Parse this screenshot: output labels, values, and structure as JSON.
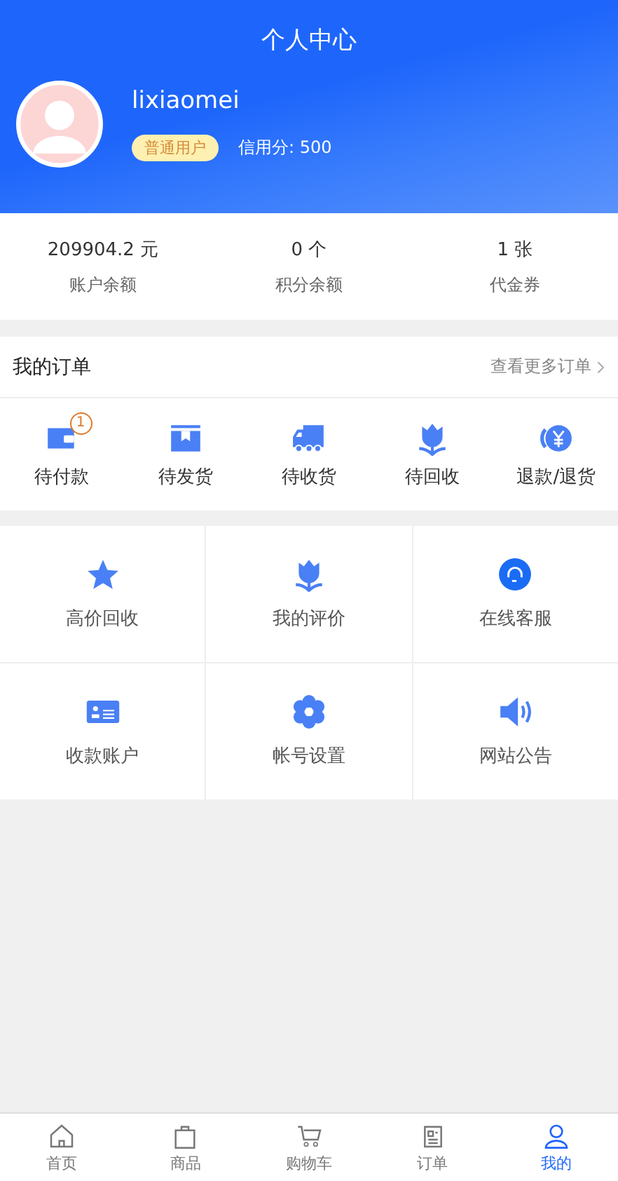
{
  "title": "个人中心",
  "profile": {
    "username": "lixiaomei",
    "level_badge": "普通用户",
    "credit": "信用分: 500"
  },
  "stats": [
    {
      "value": "209904.2 元",
      "label": "账户余额"
    },
    {
      "value": "0 个",
      "label": "积分余额"
    },
    {
      "value": "1 张",
      "label": "代金券"
    }
  ],
  "orders": {
    "heading": "我的订单",
    "more_link": "查看更多订单",
    "items": [
      {
        "kind": "wallet",
        "label": "待付款",
        "badge": "1"
      },
      {
        "kind": "box",
        "label": "待发货"
      },
      {
        "kind": "truck",
        "label": "待收货"
      },
      {
        "kind": "tulip",
        "label": "待回收"
      },
      {
        "kind": "refund",
        "label": "退款/退货"
      }
    ]
  },
  "services": [
    {
      "kind": "star",
      "label": "高价回收"
    },
    {
      "kind": "tulip",
      "label": "我的评价"
    },
    {
      "kind": "headset",
      "label": "在线客服"
    },
    {
      "kind": "idcard",
      "label": "收款账户"
    },
    {
      "kind": "gear",
      "label": "帐号设置"
    },
    {
      "kind": "speaker",
      "label": "网站公告"
    }
  ],
  "tabbar": [
    {
      "kind": "home",
      "label": "首页",
      "selected": false
    },
    {
      "kind": "bag",
      "label": "商品",
      "selected": false
    },
    {
      "kind": "cart",
      "label": "购物车",
      "selected": false
    },
    {
      "kind": "doc",
      "label": "订单",
      "selected": false
    },
    {
      "kind": "user",
      "label": "我的",
      "selected": true
    }
  ]
}
